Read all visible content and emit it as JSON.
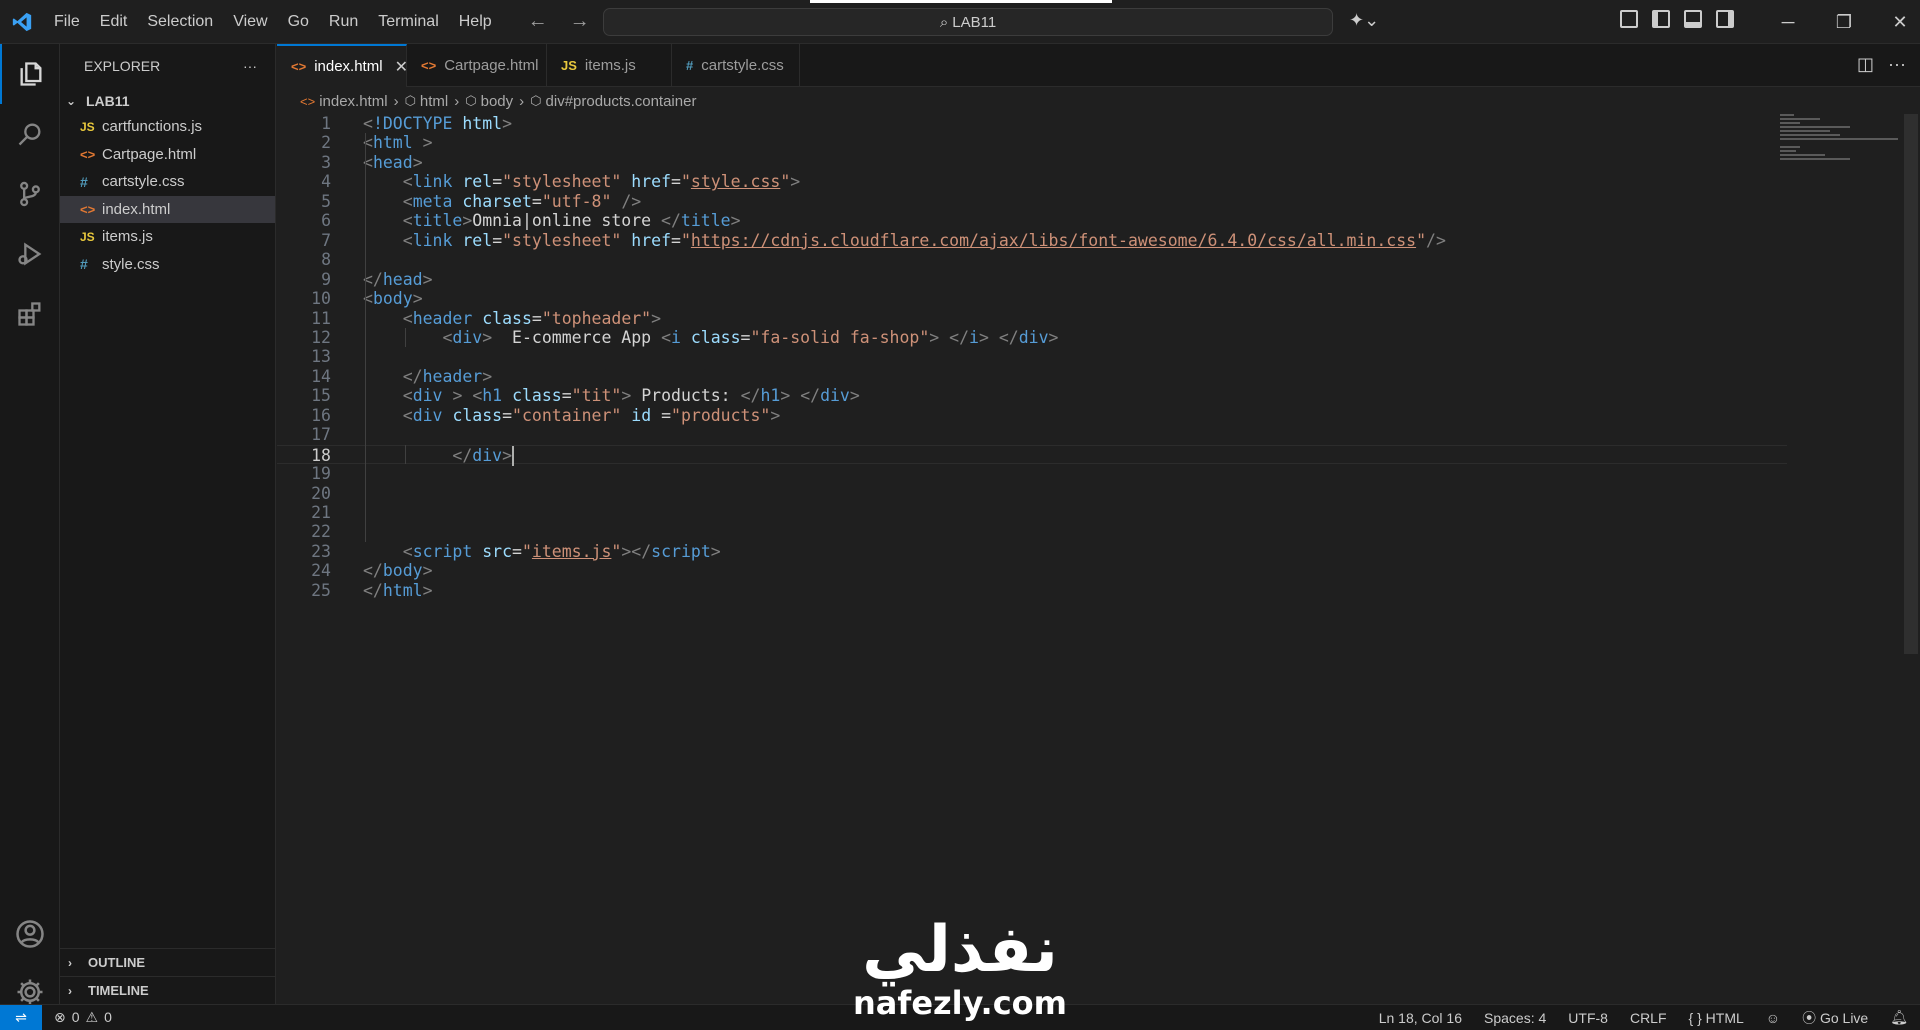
{
  "menu": [
    "File",
    "Edit",
    "Selection",
    "View",
    "Go",
    "Run",
    "Terminal",
    "Help"
  ],
  "command_center": {
    "label": "LAB11"
  },
  "explorer": {
    "title": "EXPLORER",
    "more": "···",
    "folder": "LAB11",
    "files": [
      {
        "name": "cartfunctions.js",
        "type": "js",
        "icon": "JS"
      },
      {
        "name": "Cartpage.html",
        "type": "html",
        "icon": "<>"
      },
      {
        "name": "cartstyle.css",
        "type": "css",
        "icon": "#"
      },
      {
        "name": "index.html",
        "type": "html",
        "icon": "<>",
        "selected": true
      },
      {
        "name": "items.js",
        "type": "js",
        "icon": "JS"
      },
      {
        "name": "style.css",
        "type": "css",
        "icon": "#"
      }
    ],
    "outline": "OUTLINE",
    "timeline": "TIMELINE"
  },
  "tabs": [
    {
      "label": "index.html",
      "type": "html",
      "icon": "<>",
      "active": true
    },
    {
      "label": "Cartpage.html",
      "type": "html",
      "icon": "<>"
    },
    {
      "label": "items.js",
      "type": "js",
      "icon": "JS"
    },
    {
      "label": "cartstyle.css",
      "type": "css",
      "icon": "#"
    }
  ],
  "breadcrumb": [
    "index.html",
    "html",
    "body",
    "div#products.container"
  ],
  "editor": {
    "current_line": 18,
    "lines": [
      [
        [
          "t-brk",
          "<"
        ],
        [
          "t-tag",
          "!DOCTYPE"
        ],
        [
          "t-txt",
          " "
        ],
        [
          "t-attr",
          "html"
        ],
        [
          "t-brk",
          ">"
        ]
      ],
      [
        [
          "t-brk",
          "<"
        ],
        [
          "t-tag",
          "html"
        ],
        [
          "t-txt",
          " "
        ],
        [
          "t-brk",
          ">"
        ]
      ],
      [
        [
          "t-brk",
          "<"
        ],
        [
          "t-tag",
          "head"
        ],
        [
          "t-brk",
          ">"
        ]
      ],
      [
        [
          "t-txt",
          "    "
        ],
        [
          "t-brk",
          "<"
        ],
        [
          "t-tag",
          "link"
        ],
        [
          "t-txt",
          " "
        ],
        [
          "t-attr",
          "rel"
        ],
        [
          "t-txt",
          "="
        ],
        [
          "t-str",
          "\"stylesheet\""
        ],
        [
          "t-txt",
          " "
        ],
        [
          "t-attr",
          "href"
        ],
        [
          "t-txt",
          "="
        ],
        [
          "t-str",
          "\""
        ],
        [
          "t-str-u",
          "style.css"
        ],
        [
          "t-str",
          "\""
        ],
        [
          "t-brk",
          ">"
        ]
      ],
      [
        [
          "t-txt",
          "    "
        ],
        [
          "t-brk",
          "<"
        ],
        [
          "t-tag",
          "meta"
        ],
        [
          "t-txt",
          " "
        ],
        [
          "t-attr",
          "charset"
        ],
        [
          "t-txt",
          "="
        ],
        [
          "t-str",
          "\"utf-8\""
        ],
        [
          "t-txt",
          " "
        ],
        [
          "t-brk",
          "/>"
        ]
      ],
      [
        [
          "t-txt",
          "    "
        ],
        [
          "t-brk",
          "<"
        ],
        [
          "t-tag",
          "title"
        ],
        [
          "t-brk",
          ">"
        ],
        [
          "t-txt",
          "Omnia|online store "
        ],
        [
          "t-brk",
          "</"
        ],
        [
          "t-tag",
          "title"
        ],
        [
          "t-brk",
          ">"
        ]
      ],
      [
        [
          "t-txt",
          "    "
        ],
        [
          "t-brk",
          "<"
        ],
        [
          "t-tag",
          "link"
        ],
        [
          "t-txt",
          " "
        ],
        [
          "t-attr",
          "rel"
        ],
        [
          "t-txt",
          "="
        ],
        [
          "t-str",
          "\"stylesheet\""
        ],
        [
          "t-txt",
          " "
        ],
        [
          "t-attr",
          "href"
        ],
        [
          "t-txt",
          "="
        ],
        [
          "t-str",
          "\""
        ],
        [
          "t-str-u",
          "https://cdnjs.cloudflare.com/ajax/libs/font-awesome/6.4.0/css/all.min.css"
        ],
        [
          "t-str",
          "\""
        ],
        [
          "t-brk",
          "/>"
        ]
      ],
      [],
      [
        [
          "t-brk",
          "</"
        ],
        [
          "t-tag",
          "head"
        ],
        [
          "t-brk",
          ">"
        ]
      ],
      [
        [
          "t-brk",
          "<"
        ],
        [
          "t-tag",
          "body"
        ],
        [
          "t-brk",
          ">"
        ]
      ],
      [
        [
          "t-txt",
          "    "
        ],
        [
          "t-brk",
          "<"
        ],
        [
          "t-tag",
          "header"
        ],
        [
          "t-txt",
          " "
        ],
        [
          "t-attr",
          "class"
        ],
        [
          "t-txt",
          "="
        ],
        [
          "t-str",
          "\"topheader\""
        ],
        [
          "t-brk",
          ">"
        ]
      ],
      [
        [
          "t-txt",
          "        "
        ],
        [
          "t-brk",
          "<"
        ],
        [
          "t-tag",
          "div"
        ],
        [
          "t-brk",
          ">"
        ],
        [
          "t-txt",
          "  E-commerce App "
        ],
        [
          "t-brk",
          "<"
        ],
        [
          "t-tag",
          "i"
        ],
        [
          "t-txt",
          " "
        ],
        [
          "t-attr",
          "class"
        ],
        [
          "t-txt",
          "="
        ],
        [
          "t-str",
          "\"fa-solid fa-shop\""
        ],
        [
          "t-brk",
          ">"
        ],
        [
          "t-txt",
          " "
        ],
        [
          "t-brk",
          "</"
        ],
        [
          "t-tag",
          "i"
        ],
        [
          "t-brk",
          ">"
        ],
        [
          "t-txt",
          " "
        ],
        [
          "t-brk",
          "</"
        ],
        [
          "t-tag",
          "div"
        ],
        [
          "t-brk",
          ">"
        ]
      ],
      [],
      [
        [
          "t-txt",
          "    "
        ],
        [
          "t-brk",
          "</"
        ],
        [
          "t-tag",
          "header"
        ],
        [
          "t-brk",
          ">"
        ]
      ],
      [
        [
          "t-txt",
          "    "
        ],
        [
          "t-brk",
          "<"
        ],
        [
          "t-tag",
          "div"
        ],
        [
          "t-txt",
          " "
        ],
        [
          "t-brk",
          ">"
        ],
        [
          "t-txt",
          " "
        ],
        [
          "t-brk",
          "<"
        ],
        [
          "t-tag",
          "h1"
        ],
        [
          "t-txt",
          " "
        ],
        [
          "t-attr",
          "class"
        ],
        [
          "t-txt",
          "="
        ],
        [
          "t-str",
          "\"tit\""
        ],
        [
          "t-brk",
          ">"
        ],
        [
          "t-txt",
          " Products: "
        ],
        [
          "t-brk",
          "</"
        ],
        [
          "t-tag",
          "h1"
        ],
        [
          "t-brk",
          ">"
        ],
        [
          "t-txt",
          " "
        ],
        [
          "t-brk",
          "</"
        ],
        [
          "t-tag",
          "div"
        ],
        [
          "t-brk",
          ">"
        ]
      ],
      [
        [
          "t-txt",
          "    "
        ],
        [
          "t-brk",
          "<"
        ],
        [
          "t-tag",
          "div"
        ],
        [
          "t-txt",
          " "
        ],
        [
          "t-attr",
          "class"
        ],
        [
          "t-txt",
          "="
        ],
        [
          "t-str",
          "\"container\""
        ],
        [
          "t-txt",
          " "
        ],
        [
          "t-attr",
          "id"
        ],
        [
          "t-txt",
          " ="
        ],
        [
          "t-str",
          "\"products\""
        ],
        [
          "t-brk",
          ">"
        ]
      ],
      [],
      [
        [
          "t-txt",
          "         "
        ],
        [
          "t-brk",
          "</"
        ],
        [
          "t-tag",
          "div"
        ],
        [
          "t-brk",
          ">"
        ]
      ],
      [],
      [],
      [],
      [],
      [
        [
          "t-txt",
          "    "
        ],
        [
          "t-brk",
          "<"
        ],
        [
          "t-tag",
          "script"
        ],
        [
          "t-txt",
          " "
        ],
        [
          "t-attr",
          "src"
        ],
        [
          "t-txt",
          "="
        ],
        [
          "t-str",
          "\""
        ],
        [
          "t-str-u",
          "items.js"
        ],
        [
          "t-str",
          "\""
        ],
        [
          "t-brk",
          "></"
        ],
        [
          "t-tag",
          "script"
        ],
        [
          "t-brk",
          ">"
        ]
      ],
      [
        [
          "t-brk",
          "</"
        ],
        [
          "t-tag",
          "body"
        ],
        [
          "t-brk",
          ">"
        ]
      ],
      [
        [
          "t-brk",
          "</"
        ],
        [
          "t-tag",
          "html"
        ],
        [
          "t-brk",
          ">"
        ]
      ]
    ]
  },
  "status": {
    "errors": "0",
    "warnings": "0",
    "position": "Ln 18, Col 16",
    "spaces": "Spaces: 4",
    "encoding": "UTF-8",
    "eol": "CRLF",
    "language": "HTML",
    "language_icon": "{ }",
    "golive": "Go Live"
  },
  "watermark": {
    "arabic": "نفذلي",
    "latin": "nafezly.com"
  },
  "colors": {
    "accent": "#0078d4",
    "background": "#1f1f1f",
    "sidebar": "#181818"
  }
}
